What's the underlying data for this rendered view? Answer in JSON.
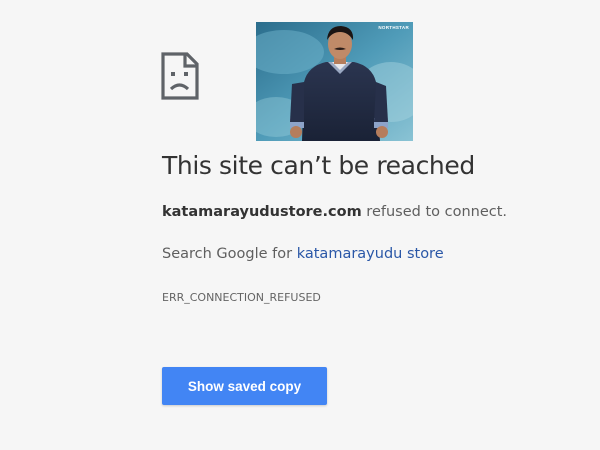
{
  "error_page": {
    "title": "This site can’t be reached",
    "domain": "katamarayudustore.com",
    "detail_suffix": " refused to connect.",
    "suggestion_prefix": "Search Google for ",
    "suggestion_link": "katamarayudu store",
    "error_code": "ERR_CONNECTION_REFUSED",
    "saved_copy_button": "Show saved copy"
  },
  "photo": {
    "watermark": "NORTHSTAR"
  },
  "icons": {
    "error_icon": "sad-page-icon"
  },
  "colors": {
    "page_background": "#f6f6f6",
    "title_text": "#333333",
    "link": "#2a57a7",
    "button": "#4285f4"
  }
}
